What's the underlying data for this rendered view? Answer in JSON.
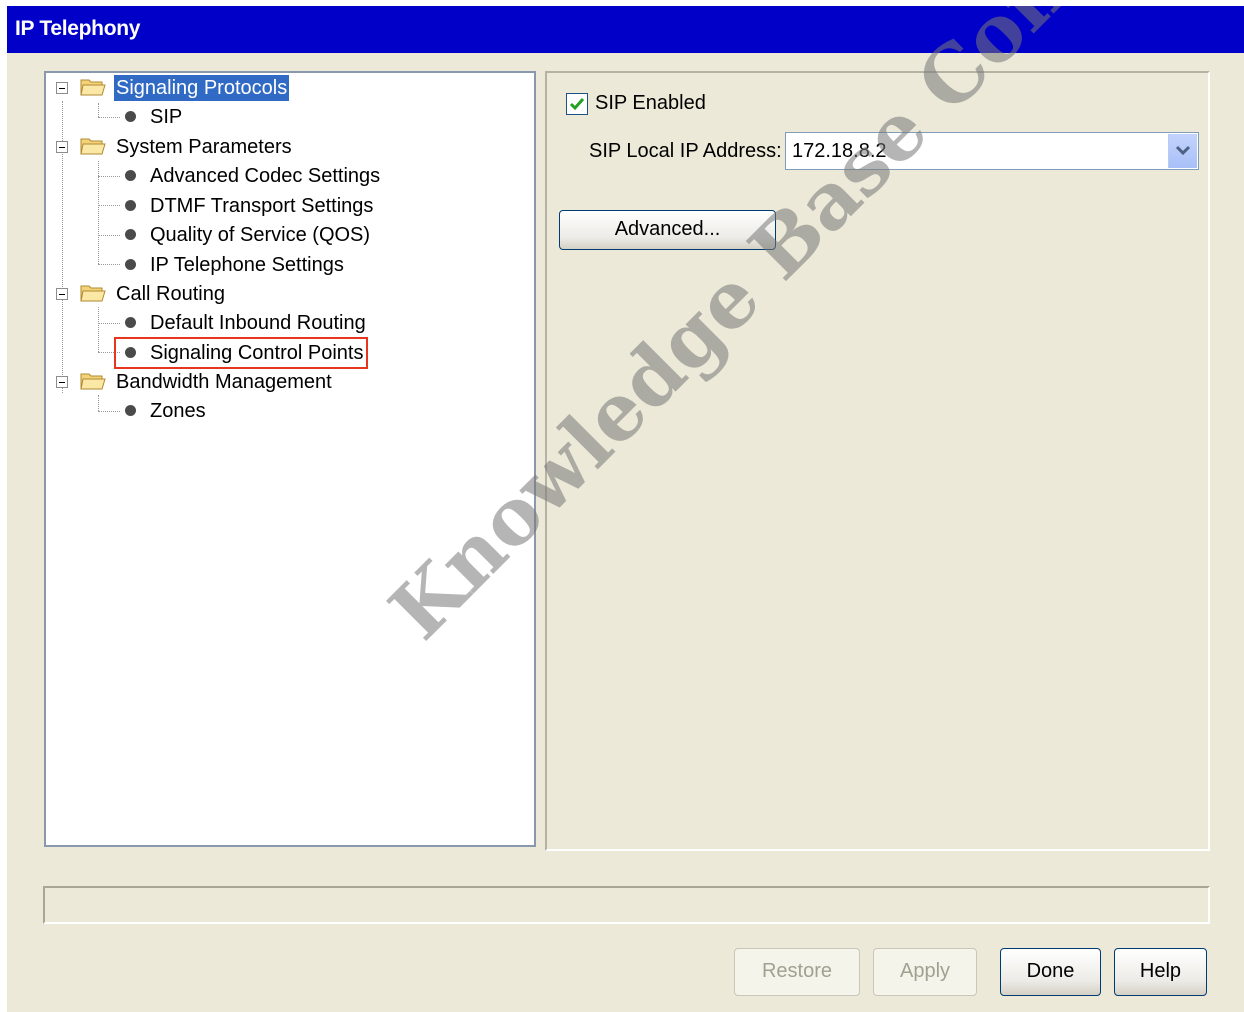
{
  "window": {
    "title": "IP Telephony"
  },
  "tree": {
    "signaling_protocols": {
      "label": "Signaling Protocols",
      "children": [
        "SIP"
      ]
    },
    "system_parameters": {
      "label": "System Parameters",
      "children": [
        "Advanced Codec Settings",
        "DTMF Transport Settings",
        "Quality of Service (QOS)",
        "IP Telephone Settings"
      ]
    },
    "call_routing": {
      "label": "Call Routing",
      "children": [
        "Default Inbound Routing",
        "Signaling Control Points"
      ]
    },
    "bandwidth_management": {
      "label": "Bandwidth Management",
      "children": [
        "Zones"
      ]
    }
  },
  "settings": {
    "sip_enabled_label": "SIP Enabled",
    "sip_enabled": true,
    "sip_ip_label": "SIP Local IP Address:",
    "sip_ip_value": "172.18.8.2",
    "advanced_label": "Advanced..."
  },
  "buttons": {
    "restore": "Restore",
    "apply": "Apply",
    "done": "Done",
    "help": "Help"
  },
  "watermark": "Knowledge Base Content",
  "colors": {
    "title_bar": "#0000c8",
    "selection": "#316ac5",
    "highlight_box": "#e8361e",
    "background": "#ece9d8"
  }
}
